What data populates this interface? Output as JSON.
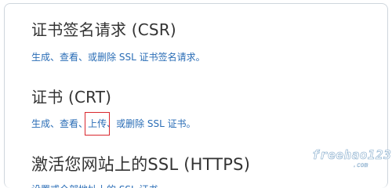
{
  "sections": [
    {
      "title": "证书签名请求 (CSR)",
      "links": {
        "generate": "生成",
        "sep1": "、",
        "view": "查看",
        "sep2": "、或",
        "delete": "删除",
        "tail": " SSL 证书签名请求。"
      }
    },
    {
      "title": "证书 (CRT)",
      "links": {
        "generate": "生成",
        "sep1": "、",
        "view": "查看",
        "sep2": "、",
        "upload": "上传",
        "sep3": "、或",
        "delete": "删除",
        "tail": " SSL 证书。"
      }
    },
    {
      "title": "激活您网站上的SSL (HTTPS)",
      "cut_text": "设置或全部地址上的 SSL 证书"
    }
  ],
  "watermark": {
    "text": "freehao123",
    "sub": ".com"
  }
}
